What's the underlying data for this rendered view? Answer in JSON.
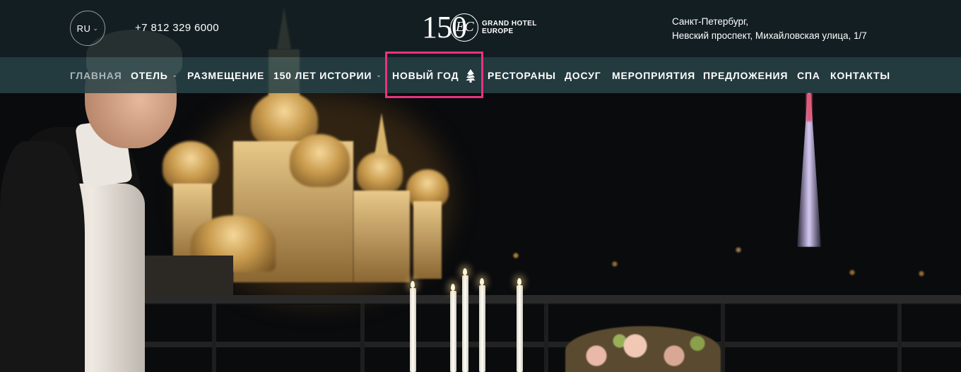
{
  "header": {
    "language": "RU",
    "phone": "+7 812 329 6000",
    "logo": {
      "number": "150",
      "monogram": "ЕС",
      "line1": "GRAND HOTEL",
      "line2": "EUROPE"
    },
    "address_line1": "Санкт-Петербург,",
    "address_line2": "Невский проспект, Михайловская улица, 1/7"
  },
  "nav": {
    "items": [
      {
        "label": "ГЛАВНАЯ"
      },
      {
        "label": "ОТЕЛЬ"
      },
      {
        "label": "РАЗМЕЩЕНИЕ"
      },
      {
        "label": "150 ЛЕТ ИСТОРИИ"
      },
      {
        "label": "НОВЫЙ ГОД"
      },
      {
        "label": "РЕСТОРАНЫ"
      },
      {
        "label": "ДОСУГ"
      },
      {
        "label": "МЕРОПРИЯТИЯ"
      },
      {
        "label": "ПРЕДЛОЖЕНИЯ"
      },
      {
        "label": "СПА"
      },
      {
        "label": "КОНТАКТЫ"
      }
    ],
    "highlight_color": "#e8337f"
  },
  "icons": {
    "language_dropdown": "chevron-down-icon",
    "hotel_dropdown": "chevron-down-icon",
    "history_dropdown": "chevron-down-icon",
    "new_year": "christmas-tree-icon"
  }
}
